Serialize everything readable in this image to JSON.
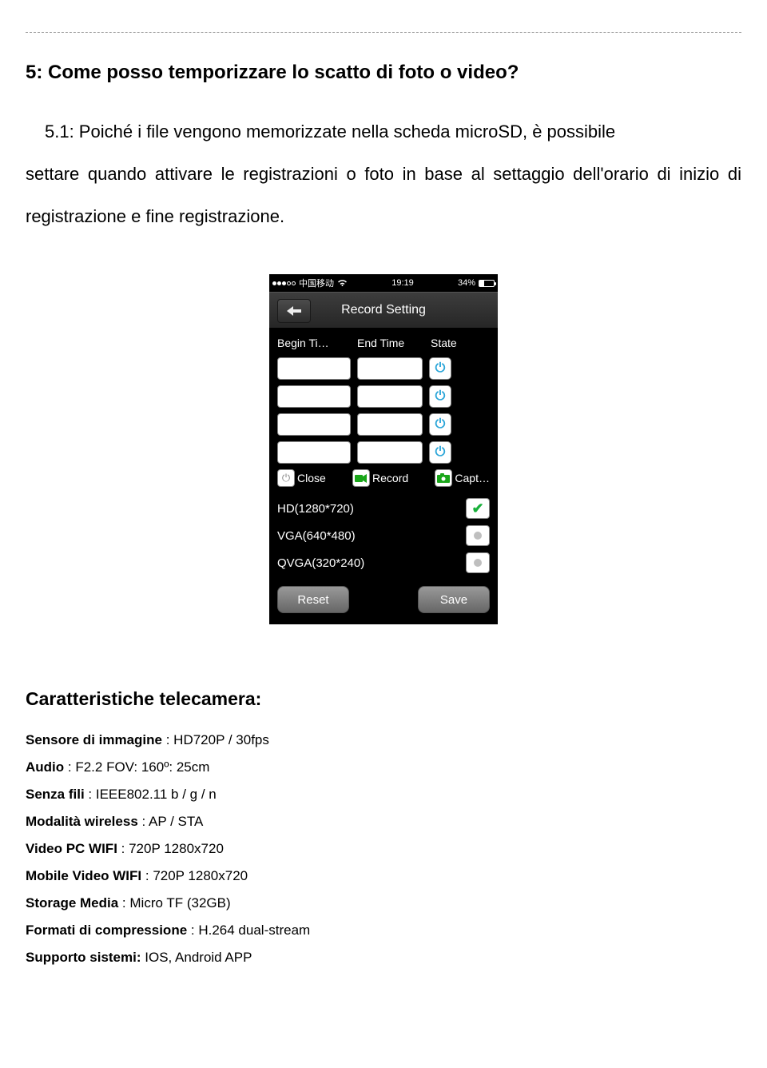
{
  "question": "5: Come posso temporizzare lo scatto di foto o video?",
  "answer_prefix": "5.1: Poiché i file vengono memorizzate nella scheda microSD, è possibile",
  "answer_rest": "settare quando attivare le registrazioni o foto in base al settaggio dell'orario di inizio di registrazione e fine registrazione.",
  "phone": {
    "carrier": "中国移动",
    "time": "19:19",
    "battery_pct": "34%",
    "nav_title": "Record Setting",
    "headers": {
      "begin": "Begin Ti…",
      "end": "End Time",
      "state": "State"
    },
    "legend": {
      "close": "Close",
      "record": "Record",
      "capture": "Capt…"
    },
    "options": {
      "hd": "HD(1280*720)",
      "vga": "VGA(640*480)",
      "qvga": "QVGA(320*240)"
    },
    "buttons": {
      "reset": "Reset",
      "save": "Save"
    }
  },
  "specs_heading": "Caratteristiche telecamera:",
  "specs": {
    "sensor_label": "Sensore di immagine",
    "sensor_value": "HD720P / 30fps",
    "audio_label": "Audio",
    "audio_value": "F2.2 FOV: 160º: 25cm",
    "wifi_label": "Senza fili",
    "wifi_value": "IEEE802.11 b / g / n",
    "wireless_mode_label": "Modalità  wireless",
    "wireless_mode_value": "AP / STA",
    "video_pc_label": "Video PC WIFI",
    "video_pc_value": "720P 1280x720",
    "video_mobile_label": "Mobile Video WIFI",
    "video_mobile_value": "720P 1280x720",
    "storage_label": "Storage Media",
    "storage_value": "Micro TF (32GB)",
    "compression_label": "Formati di compressione",
    "compression_value": "H.264 dual-stream",
    "os_label": "Supporto sistemi:",
    "os_value": "IOS, Android APP"
  }
}
